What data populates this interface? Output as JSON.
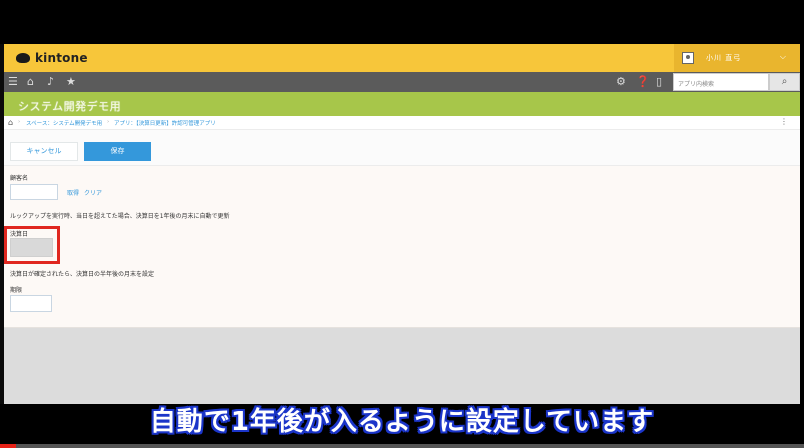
{
  "app": {
    "logo_text": "kintone",
    "user_name": "小川 直弓",
    "search_placeholder": "アプリ内検索",
    "app_title": "システム開発デモ用"
  },
  "icons": {
    "menu": "hamburger-icon",
    "home": "home-icon",
    "bell": "bell-icon",
    "star": "star-icon",
    "gear": "gear-icon",
    "help": "help-icon",
    "mobile": "mobile-icon",
    "search": "search-icon"
  },
  "breadcrumb": {
    "items": [
      "スペース：システム開発デモ用",
      "アプリ：【決算日更新】許認可管理アプリ"
    ]
  },
  "toolbar": {
    "cancel_label": "キャンセル",
    "save_label": "保存"
  },
  "form": {
    "customer_label": "顧客名",
    "fetch_link": "取得",
    "clear_link": "クリア",
    "lookup_note": "ルックアップを実行時、当日を超えてた場合、決算日を1年後の月末に自動で更新",
    "settlement_label": "決算日",
    "settlement_note": "決算日が確定されたら、決算日の半年後の月末を設定",
    "period_label": "期限"
  },
  "subtitle": "自動で1年後が入るように設定しています",
  "video": {
    "progress": 0.02,
    "progress_color": "#e62117"
  },
  "colors": {
    "header": "#f7c63a",
    "navbar": "#5b5b5b",
    "appbar": "#a7c64a",
    "accent": "#3498db",
    "highlight": "#e0271f"
  }
}
